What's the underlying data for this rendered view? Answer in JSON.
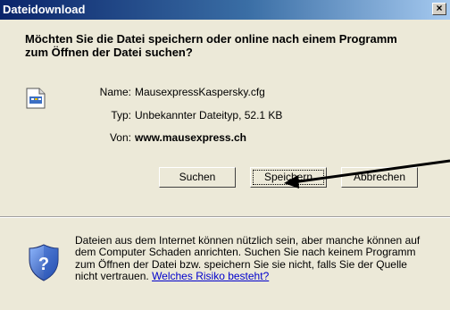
{
  "window": {
    "title": "Dateidownload",
    "close_glyph": "×"
  },
  "heading": "Möchten Sie die Datei speichern oder online nach einem Programm zum Öffnen der Datei suchen?",
  "file": {
    "icon": "cfg-file-icon",
    "name_label": "Name:",
    "name_value": "MausexpressKaspersky.cfg",
    "type_label": "Typ:",
    "type_value": "Unbekannter Dateityp, 52.1 KB",
    "from_label": "Von:",
    "from_value": "www.mausexpress.ch"
  },
  "buttons": {
    "search": "Suchen",
    "save": "Speichern",
    "cancel": "Abbrechen"
  },
  "info": {
    "text": "Dateien aus dem Internet können nützlich sein, aber manche können auf dem Computer Schaden anrichten. Suchen Sie nach keinem Programm zum Öffnen der Datei bzw. speichern Sie sie nicht, falls Sie der Quelle nicht vertrauen.",
    "link": "Welches Risiko besteht?",
    "icon": "security-shield-icon"
  },
  "colors": {
    "titlebar": "#0a246a",
    "background": "#ece9d8",
    "link": "#0000cc"
  }
}
